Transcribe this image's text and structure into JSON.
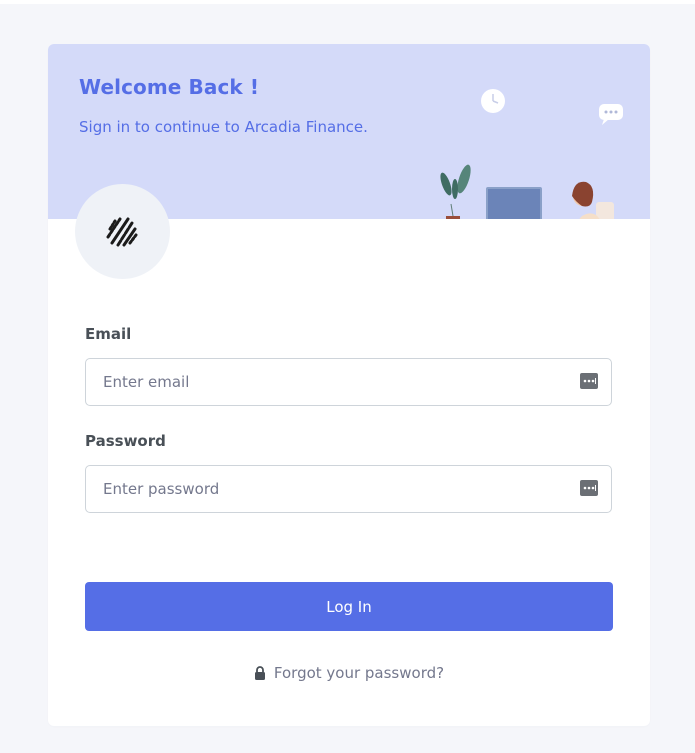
{
  "header": {
    "title": "Welcome Back !",
    "subtitle": "Sign in to continue to Arcadia Finance."
  },
  "form": {
    "email": {
      "label": "Email",
      "placeholder": "Enter email",
      "value": ""
    },
    "password": {
      "label": "Password",
      "placeholder": "Enter password",
      "value": ""
    },
    "login_label": "Log In",
    "forgot_label": "Forgot your password?"
  },
  "icons": {
    "logo": "striped-circle-logo-icon",
    "field_icon": "password-manager-key-icon",
    "forgot_icon": "lock-icon",
    "illustration": "person-at-desk-illustration"
  },
  "colors": {
    "accent": "#556ee6",
    "header_bg": "#d4daf9",
    "page_bg": "#f5f6fa",
    "logo_bg": "#eff2f7",
    "text": "#495057",
    "muted": "#74788d"
  }
}
